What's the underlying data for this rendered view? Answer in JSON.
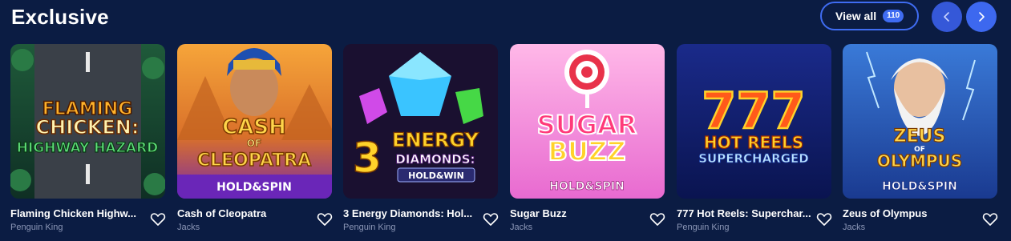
{
  "section": {
    "title": "Exclusive",
    "view_all_label": "View all",
    "view_all_count": "110",
    "prev_icon": "chevron-left-icon",
    "next_icon": "chevron-right-icon"
  },
  "colors": {
    "background": "#0b1c43",
    "accent": "#3d68ef",
    "provider_text": "#8b96b6"
  },
  "games": [
    {
      "title": "Flaming Chicken Highw...",
      "provider": "Penguin King",
      "art": {
        "line1": "FLAMING",
        "line2": "CHICKEN:",
        "line3": "HIGHWAY HAZARD"
      }
    },
    {
      "title": "Cash of Cleopatra",
      "provider": "Jacks",
      "art": {
        "line1": "CASH",
        "line2": "OF",
        "line3": "CLEOPATRA",
        "badge": "HOLD&SPIN"
      }
    },
    {
      "title": "3 Energy Diamonds: Hol...",
      "provider": "Penguin King",
      "art": {
        "line1": "3",
        "line2": "ENERGY",
        "line3": "DIAMONDS:",
        "badge": "HOLD&WIN"
      }
    },
    {
      "title": "Sugar Buzz",
      "provider": "Jacks",
      "art": {
        "line1": "SUGAR",
        "line2": "BUZZ",
        "badge": "HOLD&SPIN"
      }
    },
    {
      "title": "777 Hot Reels: Superchar...",
      "provider": "Penguin King",
      "art": {
        "line1": "777",
        "line2": "HOT REELS",
        "line3": "SUPERCHARGED"
      }
    },
    {
      "title": "Zeus of Olympus",
      "provider": "Jacks",
      "art": {
        "line1": "ZEUS",
        "line2": "OF",
        "line3": "OLYMPUS",
        "badge": "HOLD&SPIN"
      }
    }
  ]
}
